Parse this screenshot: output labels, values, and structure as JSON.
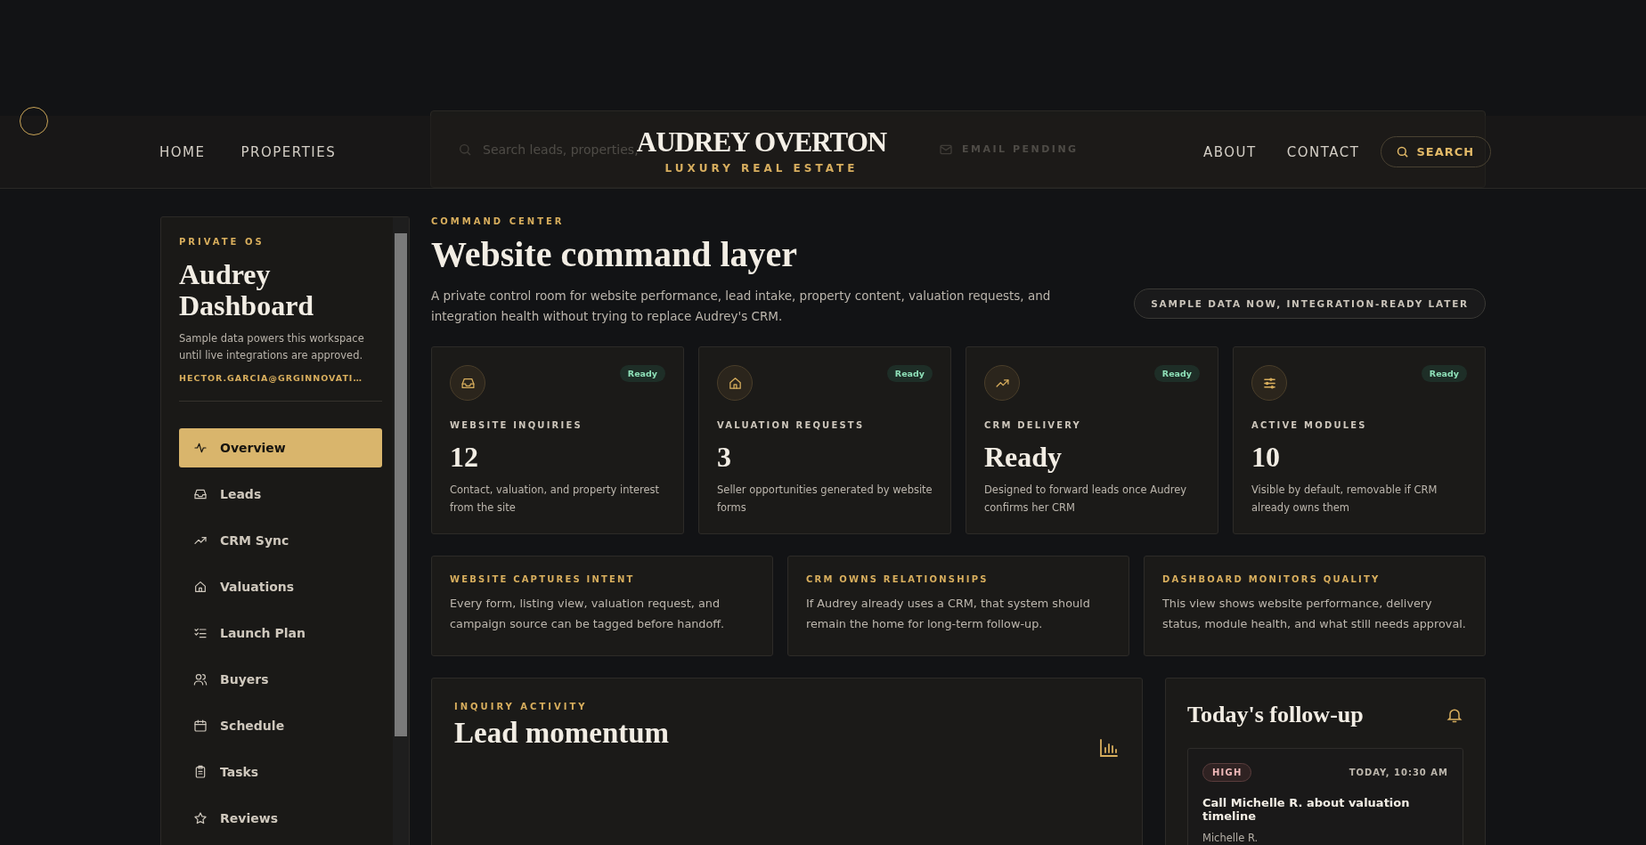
{
  "header": {
    "nav_left": [
      "HOME",
      "PROPERTIES"
    ],
    "logo": {
      "title": "AUDREY OVERTON",
      "subtitle": "LUXURY REAL ESTATE"
    },
    "nav_right": [
      "ABOUT",
      "CONTACT"
    ],
    "search_button": "SEARCH"
  },
  "toolbar": {
    "search": {
      "placeholder": "Search leads, properties,"
    },
    "status": "EMAIL PENDING"
  },
  "sidebar": {
    "eyebrow": "PRIVATE OS",
    "title": "Audrey Dashboard",
    "note": "Sample data powers this workspace until live integrations are approved.",
    "email": "HECTOR.GARCIA@GRGINNOVATI…",
    "items": [
      {
        "label": "Overview",
        "kind": "pulse",
        "selected": true
      },
      {
        "label": "Leads",
        "kind": "inbox",
        "selected": false
      },
      {
        "label": "CRM Sync",
        "kind": "trend",
        "selected": false
      },
      {
        "label": "Valuations",
        "kind": "home",
        "selected": false
      },
      {
        "label": "Launch Plan",
        "kind": "checklist",
        "selected": false
      },
      {
        "label": "Buyers",
        "kind": "users",
        "selected": false
      },
      {
        "label": "Schedule",
        "kind": "calendar",
        "selected": false
      },
      {
        "label": "Tasks",
        "kind": "clipboard",
        "selected": false
      },
      {
        "label": "Reviews",
        "kind": "star",
        "selected": false
      }
    ]
  },
  "main": {
    "eyebrow": "COMMAND CENTER",
    "title": "Website command layer",
    "intro": "A private control room for website performance, lead intake, property content, valuation requests, and integration health without trying to replace Audrey's CRM.",
    "pill": "SAMPLE DATA NOW, INTEGRATION-READY LATER",
    "stats": [
      {
        "kind": "inbox",
        "badge": "Ready",
        "label": "WEBSITE INQUIRIES",
        "value": "12",
        "note": "Contact, valuation, and property interest from the site"
      },
      {
        "kind": "home",
        "badge": "Ready",
        "label": "VALUATION REQUESTS",
        "value": "3",
        "note": "Seller opportunities generated by website forms"
      },
      {
        "kind": "trend",
        "badge": "Ready",
        "label": "CRM DELIVERY",
        "value": "Ready",
        "note": "Designed to forward leads once Audrey confirms her CRM"
      },
      {
        "kind": "sliders",
        "badge": "Ready",
        "label": "ACTIVE MODULES",
        "value": "10",
        "note": "Visible by default, removable if CRM already owns them"
      }
    ],
    "principles": [
      {
        "title": "WEBSITE CAPTURES INTENT",
        "text": "Every form, listing view, valuation request, and campaign source can be tagged before handoff."
      },
      {
        "title": "CRM OWNS RELATIONSHIPS",
        "text": "If Audrey already uses a CRM, that system should remain the home for long-term follow-up."
      },
      {
        "title": "DASHBOARD MONITORS QUALITY",
        "text": "This view shows website performance, delivery status, module health, and what still needs approval."
      }
    ],
    "activity": {
      "eyebrow": "INQUIRY ACTIVITY",
      "title": "Lead momentum"
    },
    "followup": {
      "title": "Today's follow-up",
      "items": [
        {
          "priority": "HIGH",
          "time": "TODAY, 10:30 AM",
          "title": "Call Michelle R. about valuation timeline",
          "contact": "Michelle R."
        }
      ]
    }
  }
}
